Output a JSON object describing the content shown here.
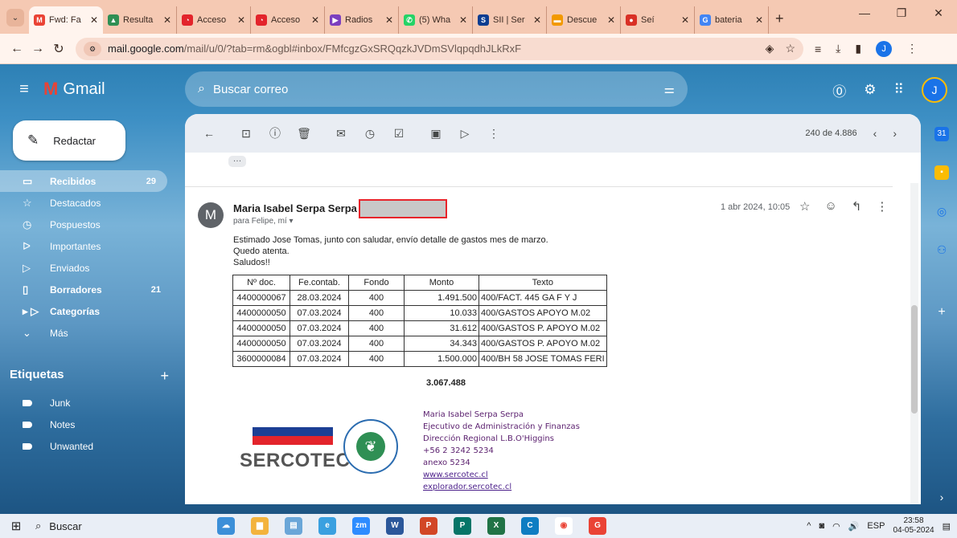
{
  "browser": {
    "tabs": [
      {
        "label": "Fwd: Fa",
        "color": "#ea4335",
        "glyph": "M",
        "active": true
      },
      {
        "label": "Resulta",
        "color": "#2f8f54",
        "glyph": "▲"
      },
      {
        "label": "Acceso",
        "color": "#e3242b",
        "glyph": "◔"
      },
      {
        "label": "Acceso",
        "color": "#e3242b",
        "glyph": "◔"
      },
      {
        "label": "Radios",
        "color": "#7b3fbf",
        "glyph": "▶"
      },
      {
        "label": "(5) Wha",
        "color": "#25d366",
        "glyph": "✆"
      },
      {
        "label": "SII | Ser",
        "color": "#0b3d91",
        "glyph": "S"
      },
      {
        "label": "Descue",
        "color": "#f29900",
        "glyph": "▬"
      },
      {
        "label": "Seí",
        "color": "#d93025",
        "glyph": "●"
      },
      {
        "label": "bateria",
        "color": "#4285f4",
        "glyph": "G"
      }
    ],
    "new_tab": "+",
    "url_domain": "mail.google.com",
    "url_path": "/mail/u/0/?tab=rm&ogbl#inbox/FMfcgzGxSRQqzkJVDmSVlqpqdhJLkRxF",
    "profile_initial": "J"
  },
  "gmail": {
    "app_name": "Gmail",
    "search_placeholder": "Buscar correo",
    "account_initial": "J",
    "compose_label": "Redactar",
    "nav": [
      {
        "label": "Recibidos",
        "count": "29",
        "icon": "▭",
        "name": "inbox",
        "active": true
      },
      {
        "label": "Destacados",
        "count": "",
        "icon": "☆",
        "name": "starred"
      },
      {
        "label": "Pospuestos",
        "count": "",
        "icon": "◷",
        "name": "snoozed"
      },
      {
        "label": "Importantes",
        "count": "",
        "icon": "ᐅ",
        "name": "important"
      },
      {
        "label": "Enviados",
        "count": "",
        "icon": "▷",
        "name": "sent"
      },
      {
        "label": "Borradores",
        "count": "21",
        "icon": "▯",
        "name": "drafts",
        "bold": true
      },
      {
        "label": "Categorías",
        "count": "",
        "icon": "▸ ▷",
        "name": "categories",
        "bold": true
      },
      {
        "label": "Más",
        "count": "",
        "icon": "⌄",
        "name": "more"
      }
    ],
    "labels_title": "Etiquetas",
    "labels": [
      "Junk",
      "Notes",
      "Unwanted"
    ],
    "pager": "240 de 4.886"
  },
  "message": {
    "sender_initial": "M",
    "sender": "Maria Isabel Serpa Serpa",
    "recipients": "para Felipe, mí ▾",
    "date": "1 abr 2024, 10:05",
    "body_lines": [
      "Estimado Jose Tomas, junto con saludar, envío detalle de gastos mes de marzo.",
      "Quedo atenta.",
      "Saludos!!"
    ],
    "table": {
      "headers": [
        "Nº doc.",
        "Fe.contab.",
        "Fondo",
        "Monto",
        "Texto"
      ],
      "rows": [
        [
          "4400000067",
          "28.03.2024",
          "400",
          "1.491.500",
          "400/FACT. 445 GA F Y J"
        ],
        [
          "4400000050",
          "07.03.2024",
          "400",
          "10.033",
          "400/GASTOS APOYO M.02"
        ],
        [
          "4400000050",
          "07.03.2024",
          "400",
          "31.612",
          "400/GASTOS P. APOYO M.02"
        ],
        [
          "4400000050",
          "07.03.2024",
          "400",
          "34.343",
          "400/GASTOS P. APOYO M.02"
        ],
        [
          "3600000084",
          "07.03.2024",
          "400",
          "1.500.000",
          "400/BH 58 JOSE TOMAS FERI"
        ]
      ],
      "total": "3.067.488"
    },
    "signature": {
      "logo_text": "SERCOTEC",
      "seal_text": "SUSTENTABILIDAD",
      "name": "Maria Isabel Serpa Serpa",
      "role": "Ejecutivo de Administración y Finanzas",
      "office": "Dirección Regional L.B.O'Higgins",
      "phone": "+56 2 3242 5234",
      "ext": "anexo 5234",
      "link1": "www.sercotec.cl",
      "link2": "explorador.sercotec.cl"
    }
  },
  "taskbar": {
    "search": "Buscar",
    "lang": "ESP",
    "time": "23:58",
    "date": "04-05-2024"
  }
}
